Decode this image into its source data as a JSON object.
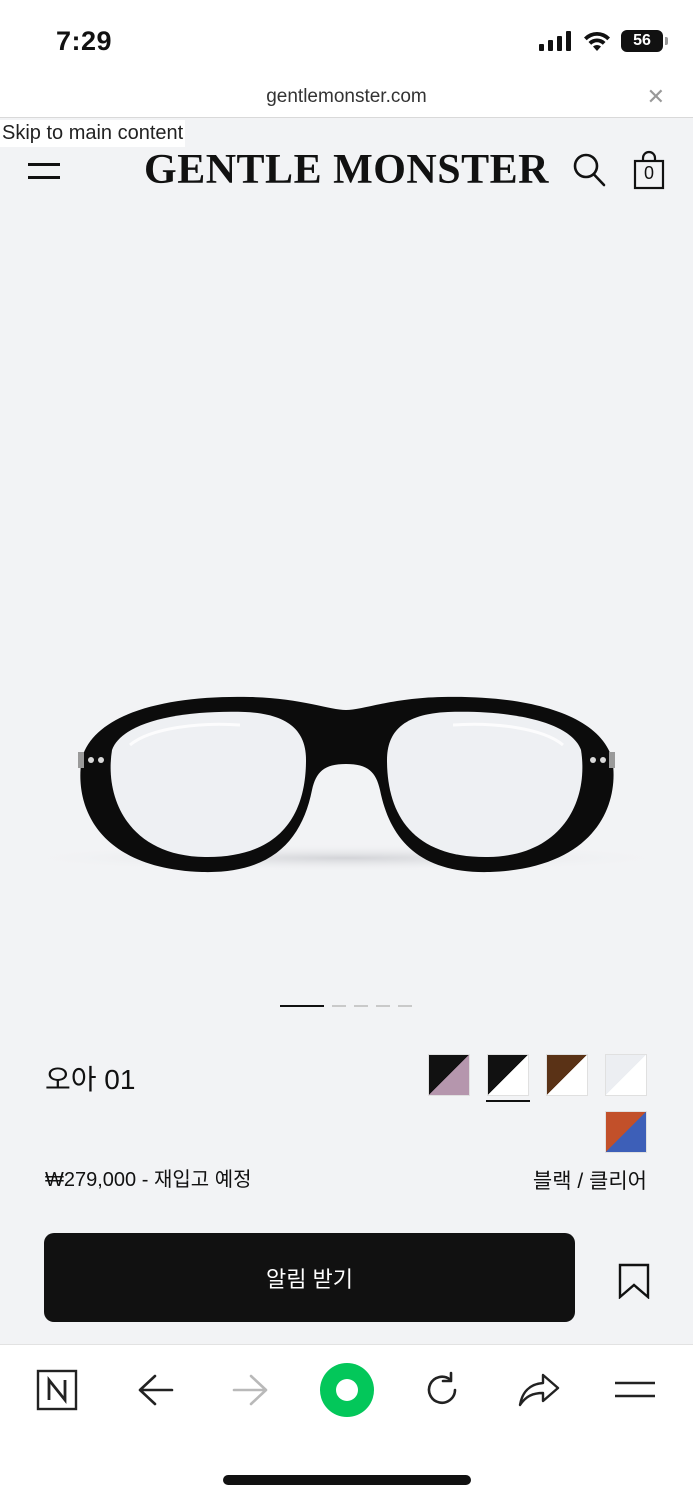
{
  "status_bar": {
    "time": "7:29",
    "battery": "56",
    "icons": [
      "cellular-signal-icon",
      "wifi-icon",
      "battery-icon"
    ]
  },
  "browser": {
    "url": "gentlemonster.com",
    "close_icon": "close-icon"
  },
  "header": {
    "skip_link": "Skip to main content",
    "logo": "GENTLE MONSTER",
    "bag_count": "0",
    "icons": [
      "menu-icon",
      "search-icon",
      "shopping-bag-icon"
    ]
  },
  "gallery": {
    "slides_total": 5,
    "active_slide": 1
  },
  "product": {
    "name": "오아 01",
    "price": "₩279,000 - 재입고 예정",
    "color_name": "블랙 / 클리어",
    "swatches": [
      {
        "label": "swatch-1",
        "colors": [
          "#111111",
          "#b596ad"
        ]
      },
      {
        "label": "swatch-2",
        "colors": [
          "#111111",
          "#ffffff"
        ],
        "selected": true
      },
      {
        "label": "swatch-3",
        "colors": [
          "#5a3216",
          "#ffffff"
        ]
      },
      {
        "label": "swatch-4",
        "colors": [
          "#eceef2",
          "#ffffff"
        ]
      },
      {
        "label": "swatch-5",
        "colors": [
          "#c2502a",
          "#3d5fb8"
        ]
      }
    ],
    "cta_label": "알림 받기",
    "bookmark_icon": "bookmark-icon"
  },
  "toolbar": {
    "items": [
      "naver-icon",
      "back-arrow-icon",
      "forward-arrow-icon",
      "green-circle-icon",
      "reload-icon",
      "share-icon",
      "menu-icon"
    ],
    "brand_color": "#03c75a"
  }
}
